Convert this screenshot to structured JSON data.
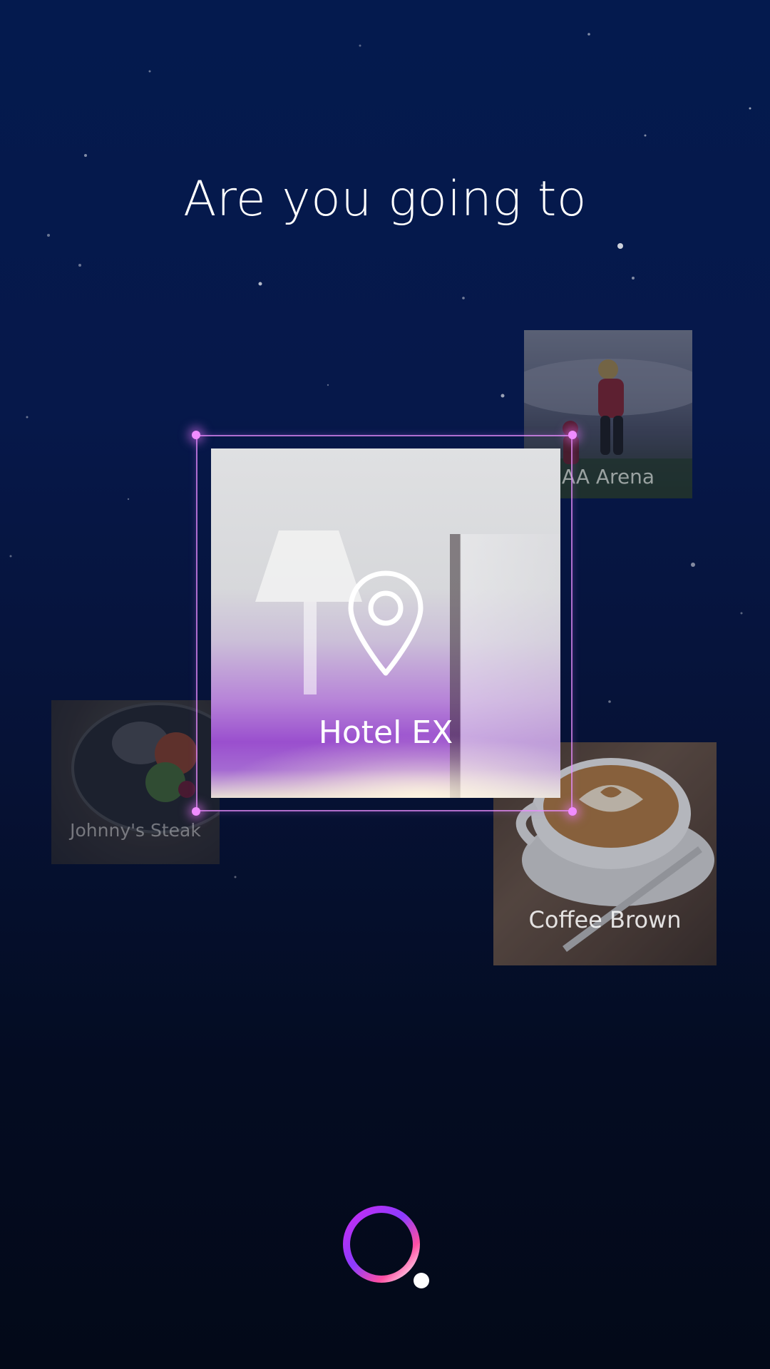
{
  "prompt": {
    "title": "Are you going to"
  },
  "places": {
    "selected": {
      "label": "Hotel EX",
      "icon": "location-pin-icon"
    },
    "options": [
      {
        "label": "AA Arena"
      },
      {
        "label": "Johnny's Steak"
      },
      {
        "label": "Coffee Brown"
      }
    ]
  },
  "assistant": {
    "icon": "voice-assistant-ring-icon"
  },
  "colors": {
    "background_top": "#041a4e",
    "background_bottom": "#030918",
    "accent": "#e06cff",
    "accent_pink": "#ff4fa3",
    "frame": "#e88cff"
  }
}
